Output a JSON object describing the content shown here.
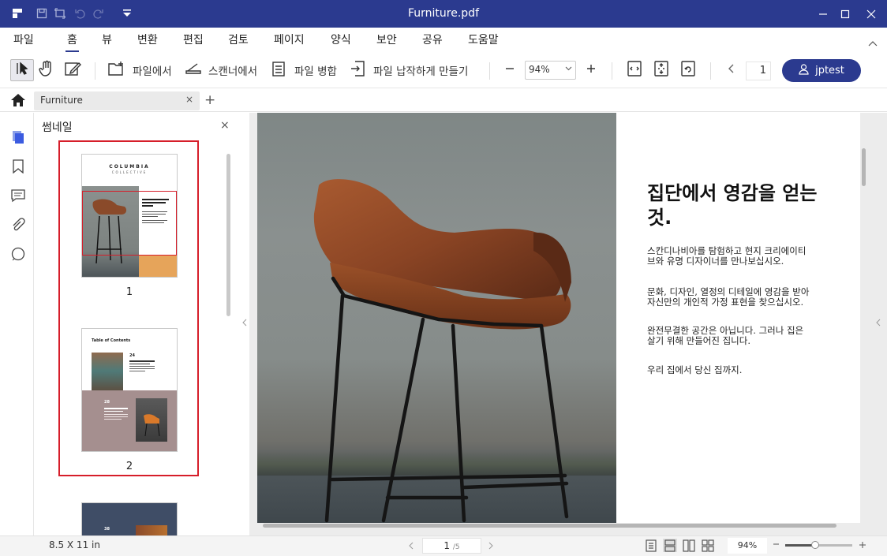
{
  "window": {
    "title": "Furniture.pdf",
    "quick_icons": [
      "app-logo-icon",
      "save-icon",
      "screenshot-icon",
      "undo-icon",
      "redo-icon",
      "quick-access-dropdown-icon"
    ]
  },
  "menu": {
    "items": [
      "파일",
      "홈",
      "뷰",
      "변환",
      "편집",
      "검토",
      "페이지",
      "양식",
      "보안",
      "공유",
      "도움말"
    ],
    "active": "홈"
  },
  "toolbar": {
    "from_file": "파일에서",
    "from_scanner": "스캔너에서",
    "merge_files": "파일 병합",
    "flatten_file": "파일 납작하게 만들기",
    "zoom_value": "94%",
    "page_input": "1",
    "user_name": "jptest"
  },
  "tabs": {
    "doc_tab": "Furniture",
    "close": "×",
    "add": "+"
  },
  "thumbnail_panel": {
    "title": "썸네일",
    "close": "×",
    "pages": [
      {
        "number": "1",
        "brand": "COLUMBIA",
        "brand_sub": "COLLECTIVE"
      },
      {
        "number": "2",
        "toc_title": "Table of Contents",
        "item_a": "24",
        "item_b": "28"
      },
      {
        "number": "",
        "item_c": "38"
      }
    ]
  },
  "document": {
    "headline": "집단에서 영감을 얻는것.",
    "paragraphs": [
      "스칸디나비아를 탐험하고 현지 크리에이티브와 유명 디자이너를 만나보십시오.",
      "문화, 디자인, 열정의 디테일에 영감을 받아 자신만의 개인적 가정 표현을 찾으십시오.",
      "완전무결한 공간은 아닙니다. 그러나 집은 살기 위해 만들어진 집니다.",
      "우리 집에서 당신 집까지."
    ]
  },
  "status": {
    "page_size": "8.5 X 11 in",
    "current_page": "1",
    "total_pages": "/5",
    "zoom": "94%",
    "zoom_fraction": 0.45
  },
  "colors": {
    "accent": "#2b3a8f",
    "selection": "#d61e2a",
    "chair_leather": "#8a4a2a"
  }
}
